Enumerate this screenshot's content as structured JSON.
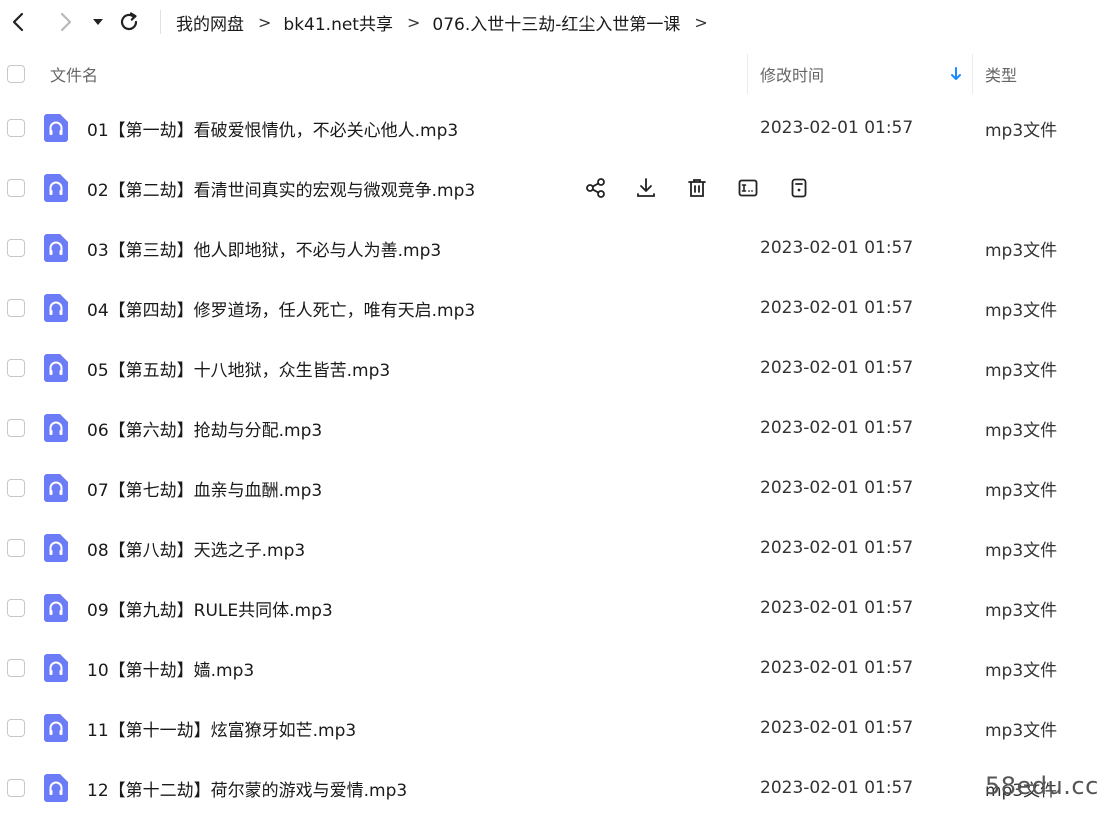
{
  "breadcrumb": [
    "我的网盘",
    "bk41.net共享",
    "076.入世十三劫-红尘入世第一课"
  ],
  "breadcrumb_separator": ">",
  "header": {
    "name": "文件名",
    "modified": "修改时间",
    "type": "类型"
  },
  "colors": {
    "accent": "#1a8cff",
    "file_icon": "#6b7cf6"
  },
  "files": [
    {
      "name": "01【第一劫】看破爱恨情仇，不必关心他人.mp3",
      "date": "2023-02-01 01:57",
      "type": "mp3文件"
    },
    {
      "name": "02【第二劫】看清世间真实的宏观与微观竞争.mp3",
      "date": "",
      "type": ""
    },
    {
      "name": "03【第三劫】他人即地狱，不必与人为善.mp3",
      "date": "2023-02-01 01:57",
      "type": "mp3文件"
    },
    {
      "name": "04【第四劫】修罗道场，任人死亡，唯有天启.mp3",
      "date": "2023-02-01 01:57",
      "type": "mp3文件"
    },
    {
      "name": "05【第五劫】十八地狱，众生皆苦.mp3",
      "date": "2023-02-01 01:57",
      "type": "mp3文件"
    },
    {
      "name": "06【第六劫】抢劫与分配.mp3",
      "date": "2023-02-01 01:57",
      "type": "mp3文件"
    },
    {
      "name": "07【第七劫】血亲与血酬.mp3",
      "date": "2023-02-01 01:57",
      "type": "mp3文件"
    },
    {
      "name": "08【第八劫】天选之子.mp3",
      "date": "2023-02-01 01:57",
      "type": "mp3文件"
    },
    {
      "name": "09【第九劫】RULE共同体.mp3",
      "date": "2023-02-01 01:57",
      "type": "mp3文件"
    },
    {
      "name": "10【第十劫】嫱.mp3",
      "date": "2023-02-01 01:57",
      "type": "mp3文件"
    },
    {
      "name": "11【第十一劫】炫富獠牙如芒.mp3",
      "date": "2023-02-01 01:57",
      "type": "mp3文件"
    },
    {
      "name": "12【第十二劫】荷尔蒙的游戏与爱情.mp3",
      "date": "2023-02-01 01:57",
      "type": "mp3文件"
    }
  ],
  "hover_actions": [
    "share-icon",
    "download-icon",
    "delete-icon",
    "rename-icon",
    "more-icon"
  ],
  "watermark": "58edu.cc"
}
